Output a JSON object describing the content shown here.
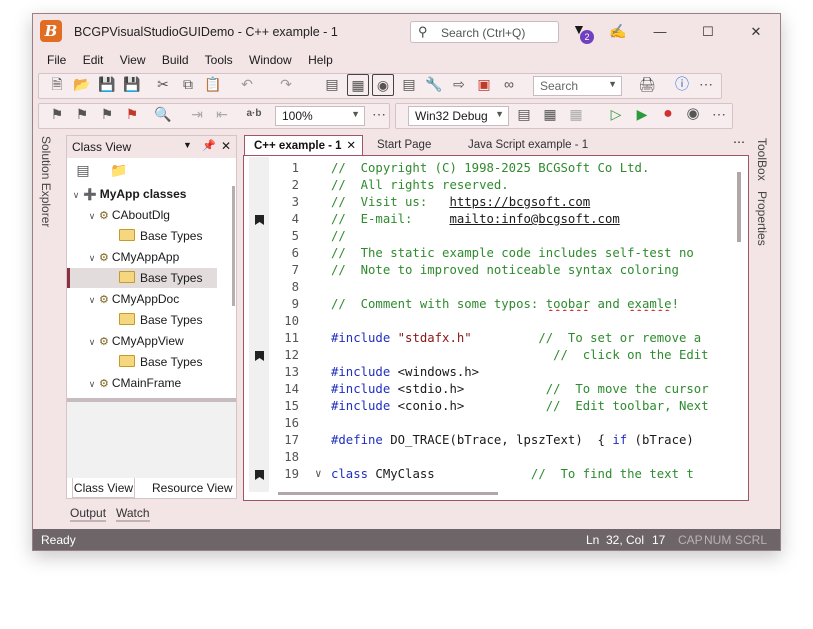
{
  "window": {
    "title": "BCGPVisualStudioGUIDemo - C++ example - 1",
    "search_placeholder": "Search (Ctrl+Q)",
    "notification_count": "2"
  },
  "menu": [
    "File",
    "Edit",
    "View",
    "Build",
    "Tools",
    "Window",
    "Help"
  ],
  "toolbar": {
    "search_placeholder": "Search",
    "zoom": "100%",
    "config": "Win32 Debug",
    "ab_label": "a·b"
  },
  "side_tabs": {
    "left": "Solution Explorer",
    "right_toolbox": "ToolBox",
    "right_properties": "Properties"
  },
  "class_view": {
    "title": "Class View",
    "root": "MyApp classes",
    "items": [
      {
        "label": "CAboutDlg",
        "kind": "class"
      },
      {
        "label": "Base Types",
        "kind": "folder"
      },
      {
        "label": "CMyAppApp",
        "kind": "class"
      },
      {
        "label": "Base Types",
        "kind": "folder"
      },
      {
        "label": "CMyAppDoc",
        "kind": "class"
      },
      {
        "label": "Base Types",
        "kind": "folder"
      },
      {
        "label": "CMyAppView",
        "kind": "class"
      },
      {
        "label": "Base Types",
        "kind": "folder"
      },
      {
        "label": "CMainFrame",
        "kind": "class"
      }
    ],
    "tabs": [
      "Class View",
      "Resource View"
    ]
  },
  "doc_tabs": [
    "C++ example - 1",
    "Start Page",
    "Java Script example - 1"
  ],
  "bottom_tabs": [
    "Output",
    "Watch"
  ],
  "code_lines": [
    {
      "n": "1",
      "parts": [
        {
          "t": "//  Copyright (C) 1998-2025 BCGSoft Co Ltd.",
          "c": "com"
        }
      ]
    },
    {
      "n": "2",
      "parts": [
        {
          "t": "//  All rights reserved.",
          "c": "com"
        }
      ]
    },
    {
      "n": "3",
      "parts": [
        {
          "t": "//  Visit us:   ",
          "c": "com"
        },
        {
          "t": "https://bcgsoft.com",
          "c": "url"
        }
      ]
    },
    {
      "n": "4",
      "parts": [
        {
          "t": "//  E-mail:     ",
          "c": "com"
        },
        {
          "t": "mailto:info@bcgsoft.com",
          "c": "url"
        }
      ]
    },
    {
      "n": "5",
      "parts": [
        {
          "t": "//",
          "c": "com"
        }
      ]
    },
    {
      "n": "6",
      "parts": [
        {
          "t": "//  The static example code includes self-test no",
          "c": "com"
        }
      ]
    },
    {
      "n": "7",
      "parts": [
        {
          "t": "//  Note to improved noticeable syntax coloring",
          "c": "com"
        }
      ]
    },
    {
      "n": "8",
      "parts": []
    },
    {
      "n": "9",
      "parts": [
        {
          "t": "//  Comment with some typos: ",
          "c": "com"
        },
        {
          "t": "toobar",
          "c": "sq"
        },
        {
          "t": " and ",
          "c": "com"
        },
        {
          "t": "examle",
          "c": "sq"
        },
        {
          "t": "!",
          "c": "com"
        }
      ]
    },
    {
      "n": "10",
      "parts": []
    },
    {
      "n": "11",
      "parts": [
        {
          "t": "#include",
          "c": "kw"
        },
        {
          "t": " ",
          "c": ""
        },
        {
          "t": "\"stdafx.h\"",
          "c": "str"
        },
        {
          "t": "         //  To set or remove a",
          "c": "com"
        }
      ]
    },
    {
      "n": "12",
      "parts": [
        {
          "t": "                              //  click on the Edit",
          "c": "com"
        }
      ]
    },
    {
      "n": "13",
      "parts": [
        {
          "t": "#include",
          "c": "kw"
        },
        {
          "t": " <windows.h>",
          "c": ""
        }
      ]
    },
    {
      "n": "14",
      "parts": [
        {
          "t": "#include",
          "c": "kw"
        },
        {
          "t": " <stdio.h>",
          "c": ""
        },
        {
          "t": "           //  To move the cursor",
          "c": "com"
        }
      ]
    },
    {
      "n": "15",
      "parts": [
        {
          "t": "#include",
          "c": "kw"
        },
        {
          "t": " <conio.h>",
          "c": ""
        },
        {
          "t": "           //  Edit toolbar, Next",
          "c": "com"
        }
      ]
    },
    {
      "n": "16",
      "parts": []
    },
    {
      "n": "17",
      "parts": [
        {
          "t": "#define",
          "c": "kw"
        },
        {
          "t": " DO_TRACE(bTrace, lpszText)  { ",
          "c": ""
        },
        {
          "t": "if",
          "c": "kw"
        },
        {
          "t": " (bTrace)",
          "c": ""
        }
      ]
    },
    {
      "n": "18",
      "parts": []
    },
    {
      "n": "19",
      "parts": [
        {
          "t": "class",
          "c": "kw"
        },
        {
          "t": " CMyClass",
          "c": ""
        },
        {
          "t": "             //  To find the text t",
          "c": "com"
        }
      ]
    }
  ],
  "status": {
    "ready": "Ready",
    "ln": "Ln",
    "ln_val": "32,",
    "col": "Col",
    "col_val": "17",
    "cap": "CAP",
    "num": "NUM",
    "scrl": "SCRL"
  }
}
